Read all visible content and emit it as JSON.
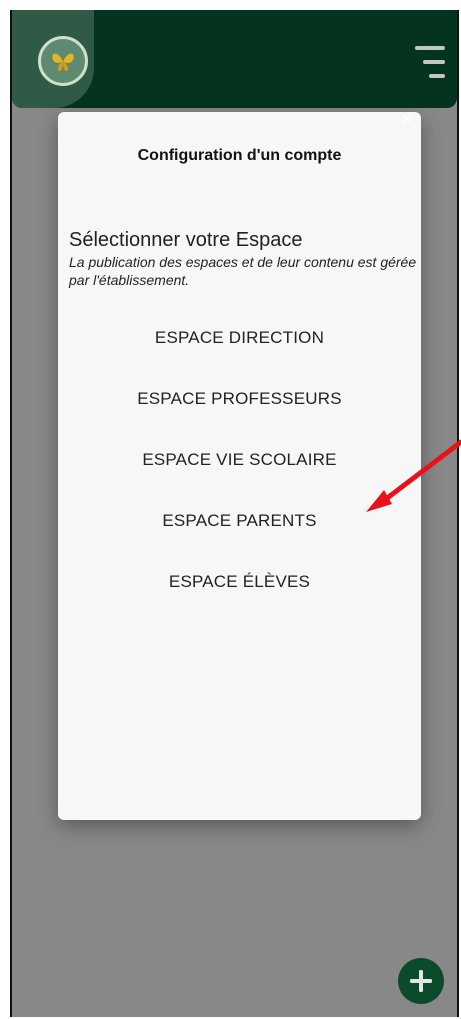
{
  "header": {
    "logo_icon": "butterfly-icon",
    "menu_icon": "hamburger-menu-icon",
    "brand_color": "#04341f"
  },
  "dialog": {
    "close_icon": "close-icon",
    "title": "Configuration d'un compte",
    "section_heading": "Sélectionner votre Espace",
    "section_desc": "La publication des espaces et de leur contenu est gérée par l'établissement.",
    "options": [
      {
        "label": "ESPACE DIRECTION"
      },
      {
        "label": "ESPACE PROFESSEURS"
      },
      {
        "label": "ESPACE VIE SCOLAIRE"
      },
      {
        "label": "ESPACE PARENTS"
      },
      {
        "label": "ESPACE ÉLÈVES"
      }
    ]
  },
  "fab": {
    "icon": "plus-icon"
  },
  "annotation": {
    "arrow_color": "#e8131a",
    "arrow_icon": "red-arrow-annotation"
  }
}
